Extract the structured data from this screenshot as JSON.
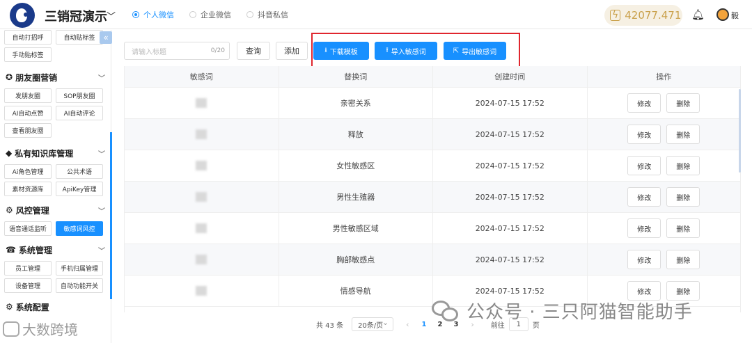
{
  "header": {
    "app_title": "三销冠演示",
    "radios": [
      {
        "label": "个人微信",
        "selected": true
      },
      {
        "label": "企业微信",
        "selected": false
      },
      {
        "label": "抖音私信",
        "selected": false
      }
    ],
    "balance": "42077.471",
    "user_name": "毅"
  },
  "sidebar": {
    "top_buttons": [
      "自动打招呼",
      "自动贴标签",
      "手动贴标签"
    ],
    "groups": [
      {
        "title": "朋友圈营销",
        "icon": "aperture-icon",
        "buttons": [
          "发朋友圈",
          "SOP朋友圈",
          "AI自动点赞",
          "AI自动评论",
          "查看朋友圈"
        ]
      },
      {
        "title": "私有知识库管理",
        "icon": "tag-icon",
        "buttons": [
          "Ai角色管理",
          "公共术语",
          "素材资源库",
          "ApiKey管理"
        ]
      },
      {
        "title": "风控管理",
        "icon": "settings-icon",
        "buttons": [
          "语音通话监听",
          "敏感词风控"
        ],
        "active": "敏感词风控"
      },
      {
        "title": "系统管理",
        "icon": "phone-icon",
        "buttons": [
          "员工管理",
          "手机归属管理",
          "设备管理",
          "自动功能开关"
        ]
      },
      {
        "title": "系统配置",
        "icon": "gear-icon",
        "buttons": []
      }
    ]
  },
  "toolbar": {
    "search_placeholder": "请输入标题",
    "search_count": "0/20",
    "query_label": "查询",
    "add_label": "添加",
    "download_label": "下载模板",
    "import_label": "导入敏感词",
    "export_label": "导出敏感词"
  },
  "table": {
    "headers": [
      "敏感词",
      "替换词",
      "创建时间",
      "操作"
    ],
    "rows": [
      {
        "replace": "亲密关系",
        "time": "2024-07-15 17:52"
      },
      {
        "replace": "释放",
        "time": "2024-07-15 17:52"
      },
      {
        "replace": "女性敏感区",
        "time": "2024-07-15 17:52"
      },
      {
        "replace": "男性生殖器",
        "time": "2024-07-15 17:52"
      },
      {
        "replace": "男性敏感区域",
        "time": "2024-07-15 17:52"
      },
      {
        "replace": "胸部敏感点",
        "time": "2024-07-15 17:52"
      },
      {
        "replace": "情感导航",
        "time": "2024-07-15 17:52"
      }
    ],
    "edit_label": "修改",
    "delete_label": "删除"
  },
  "pagination": {
    "total": "共 43 条",
    "page_size": "20条/页",
    "pages": [
      "1",
      "2",
      "3"
    ],
    "goto_label": "前往",
    "goto_value": "1",
    "page_suffix": "页"
  },
  "watermarks": {
    "wechat": "公众号 · 三只阿猫智能助手",
    "corner": "大数跨境"
  }
}
